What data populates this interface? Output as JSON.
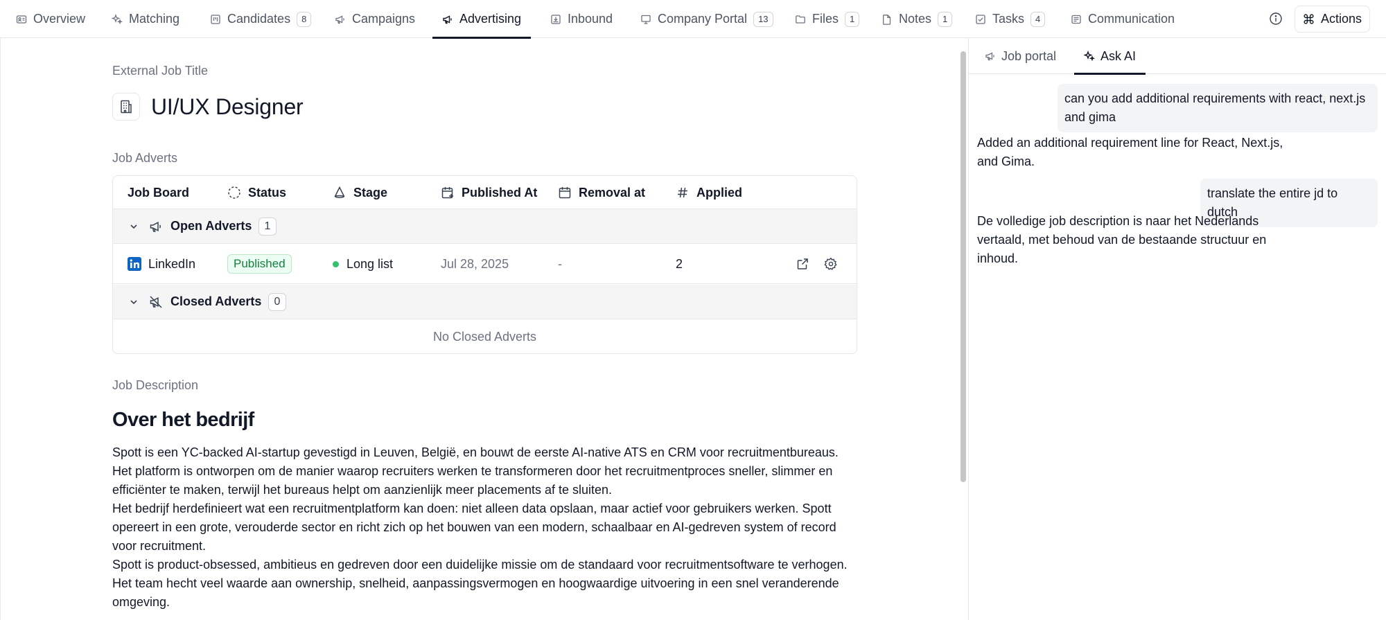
{
  "nav": {
    "tabs": [
      {
        "label": "Overview",
        "icon": "id-card-icon"
      },
      {
        "label": "Matching",
        "icon": "sparkles-icon"
      },
      {
        "label": "Candidates",
        "icon": "kanban-icon",
        "badge": "8"
      },
      {
        "label": "Campaigns",
        "icon": "megaphone-icon"
      },
      {
        "label": "Advertising",
        "icon": "megaphone-icon",
        "active": true
      },
      {
        "label": "Inbound",
        "icon": "inbox-icon"
      },
      {
        "label": "Company Portal",
        "icon": "presentation-icon",
        "badge": "13"
      },
      {
        "label": "Files",
        "icon": "folder-icon",
        "badge": "1"
      },
      {
        "label": "Notes",
        "icon": "file-icon",
        "badge": "1"
      },
      {
        "label": "Tasks",
        "icon": "checkbox-icon",
        "badge": "4"
      },
      {
        "label": "Communication",
        "icon": "message-icon"
      }
    ],
    "actions_label": "Actions"
  },
  "main": {
    "external_title_label": "External Job Title",
    "job_title": "UI/UX Designer",
    "job_adverts_label": "Job Adverts",
    "table": {
      "headers": [
        "Job Board",
        "Status",
        "Stage",
        "Published At",
        "Removal at",
        "Applied"
      ],
      "open_group": {
        "label": "Open Adverts",
        "count": "1"
      },
      "rows": [
        {
          "board": "LinkedIn",
          "status": "Published",
          "stage": "Long list",
          "published_at": "Jul 28, 2025",
          "removal_at": "-",
          "applied": "2"
        }
      ],
      "closed_group": {
        "label": "Closed Adverts",
        "count": "0"
      },
      "closed_empty": "No Closed Adverts"
    },
    "job_description_label": "Job Description",
    "description": {
      "heading": "Over het bedrijf",
      "lines": [
        "Spott is een YC-backed AI-startup gevestigd in Leuven, België, en bouwt de eerste AI-native ATS en CRM voor recruitmentbureaus.",
        "Het platform is ontworpen om de manier waarop recruiters werken te transformeren door het recruitmentproces sneller, slimmer en",
        "efficiënter te maken, terwijl het bureaus helpt om aanzienlijk meer placements af te sluiten.",
        "Het bedrijf herdefinieert wat een recruitmentplatform kan doen: niet alleen data opslaan, maar actief voor gebruikers werken. Spott",
        "opereert in een grote, verouderde sector en richt zich op het bouwen van een modern, schaalbaar en AI-gedreven system of record",
        "voor recruitment.",
        "Spott is product-obsessed, ambitieus en gedreven door een duidelijke missie om de standaard voor recruitmentsoftware te verhogen.",
        "Het team hecht veel waarde aan ownership, snelheid, aanpassingsvermogen en hoogwaardige uitvoering in een snel veranderende",
        "omgeving."
      ]
    }
  },
  "panel": {
    "tabs": [
      {
        "label": "Job portal",
        "icon": "megaphone-icon"
      },
      {
        "label": "Ask AI",
        "icon": "sparkles-icon",
        "active": true
      }
    ],
    "messages": [
      {
        "role": "user",
        "lines": [
          "can you add additional requirements with react, next.js",
          "and gima"
        ]
      },
      {
        "role": "assistant",
        "lines": [
          "Added an additional requirement line for React, Next.js,",
          "and Gima."
        ]
      },
      {
        "role": "user",
        "lines": [
          "translate the entire jd to dutch"
        ]
      },
      {
        "role": "assistant",
        "lines": [
          "De volledige job description is naar het Nederlands",
          "vertaald, met behoud van de bestaande structuur en",
          "inhoud."
        ]
      }
    ]
  },
  "colors": {
    "accent": "#111827",
    "published_bg": "#ecfdf3",
    "published_text": "#15803d",
    "stage_dot": "#34c170",
    "linkedin": "#0a66c2"
  }
}
